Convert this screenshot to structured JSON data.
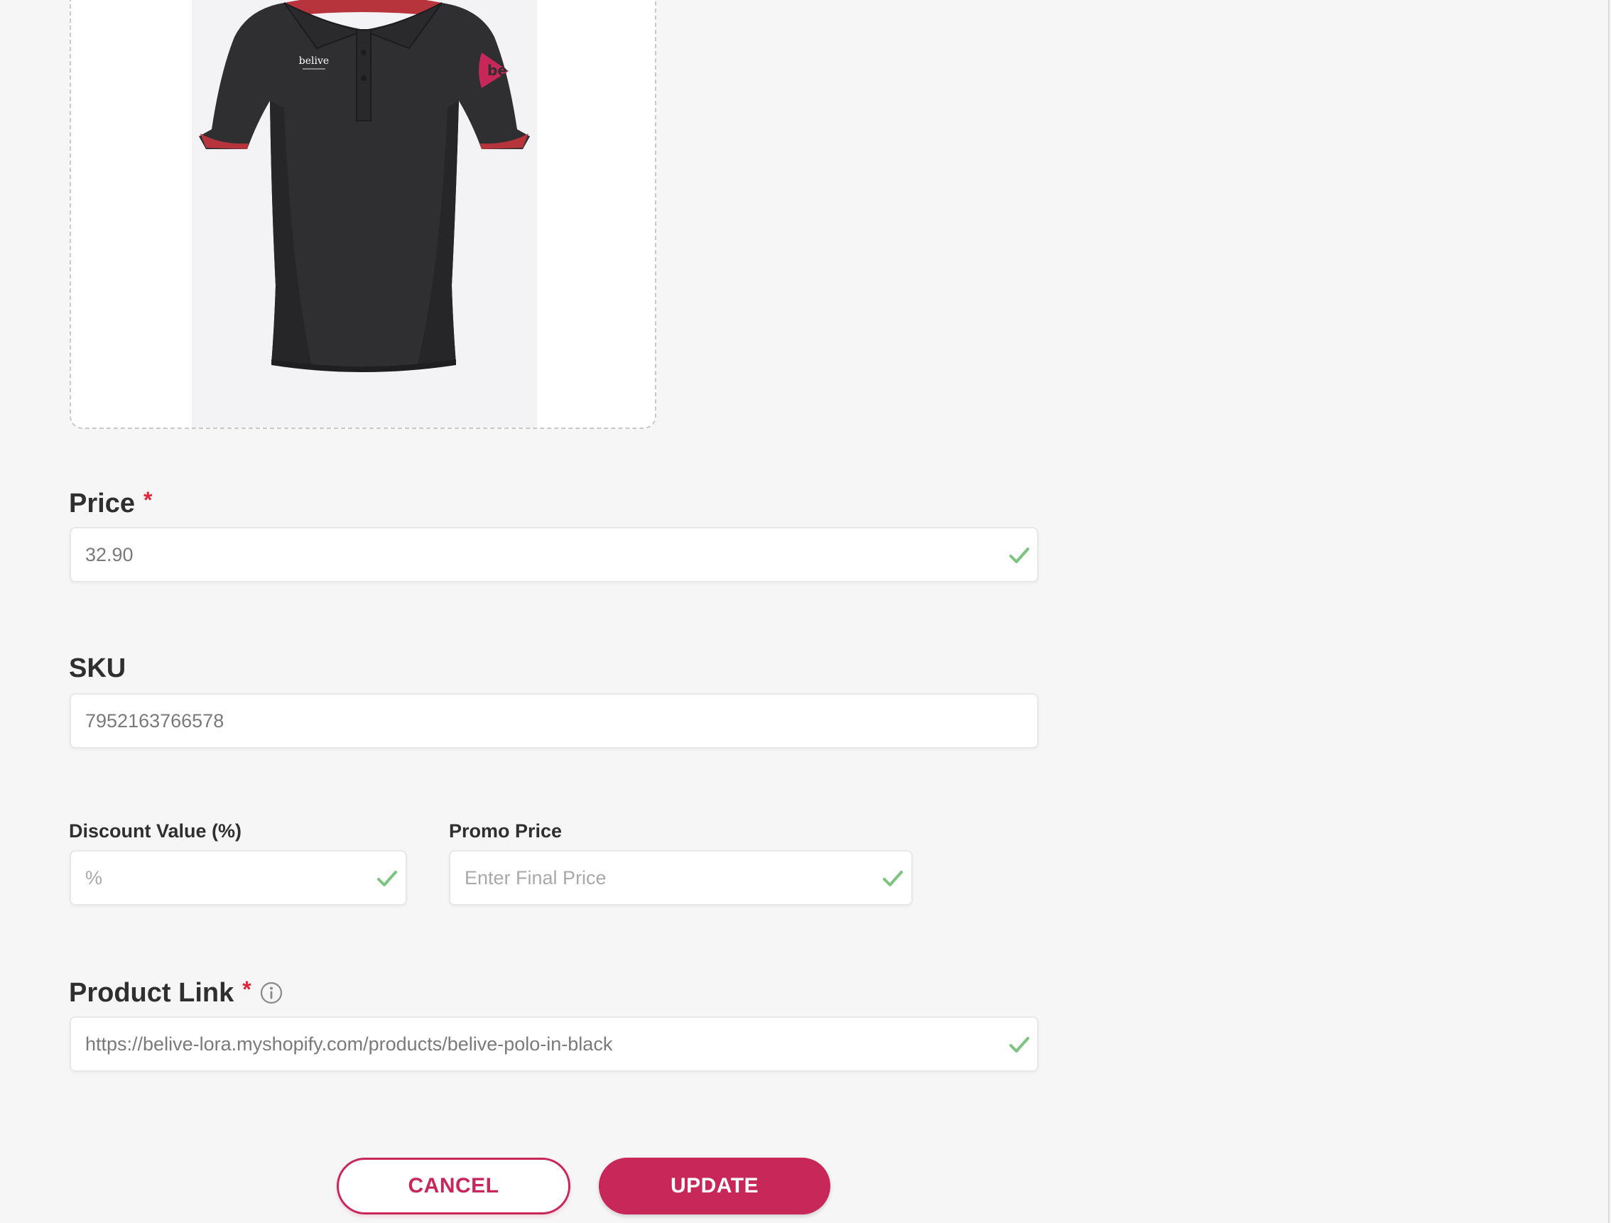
{
  "product_image": {
    "alt": "Black polo shirt with red trim",
    "shirt_print": "belive",
    "logo_text": "be"
  },
  "price": {
    "label": "Price",
    "required_mark": "*",
    "value": "32.90",
    "valid": true
  },
  "sku": {
    "label": "SKU",
    "value": "7952163766578"
  },
  "discount": {
    "label": "Discount Value (%)",
    "value": "",
    "placeholder": "%",
    "valid": true
  },
  "promo_price": {
    "label": "Promo Price",
    "value": "",
    "placeholder": "Enter Final Price",
    "valid": true
  },
  "product_link": {
    "label": "Product Link",
    "required_mark": "*",
    "value": "https://belive-lora.myshopify.com/products/belive-polo-in-black",
    "valid": true
  },
  "actions": {
    "cancel_label": "CANCEL",
    "update_label": "UPDATE"
  },
  "colors": {
    "accent": "#c8275a",
    "required": "#e0263a",
    "valid_check": "#7cc47f",
    "background": "#f6f6f6"
  },
  "icons": {
    "valid": "check-icon",
    "info": "info-icon"
  }
}
